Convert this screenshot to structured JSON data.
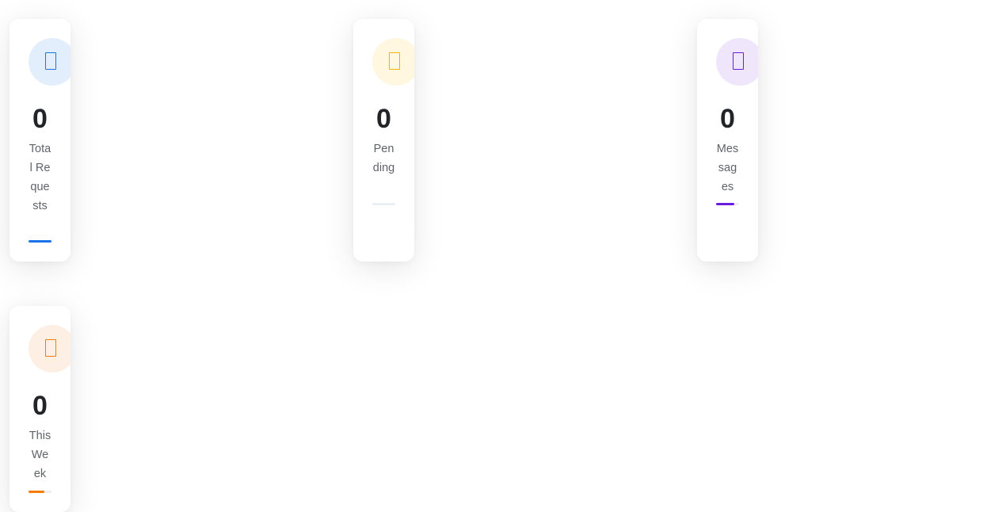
{
  "stats": [
    {
      "id": "total-requests",
      "icon": "document-icon",
      "value": "0",
      "label": "Total Requests",
      "accent": "#1a73e8",
      "icon_bg": "#e3eefc",
      "progress_fraction": 1.0
    },
    {
      "id": "pending",
      "icon": "clock-icon",
      "value": "0",
      "label": "Pending",
      "accent": "#f5b400",
      "icon_bg": "#fff7e0",
      "progress_fraction": 0.0
    },
    {
      "id": "messages",
      "icon": "message-icon",
      "value": "0",
      "label": "Messages",
      "accent": "#6a1be0",
      "icon_bg": "#efe6fc",
      "progress_fraction": 0.8
    },
    {
      "id": "this-week",
      "icon": "calendar-icon",
      "value": "0",
      "label": "This Week",
      "accent": "#f57c00",
      "icon_bg": "#fdefe3",
      "progress_fraction": 0.7
    }
  ]
}
